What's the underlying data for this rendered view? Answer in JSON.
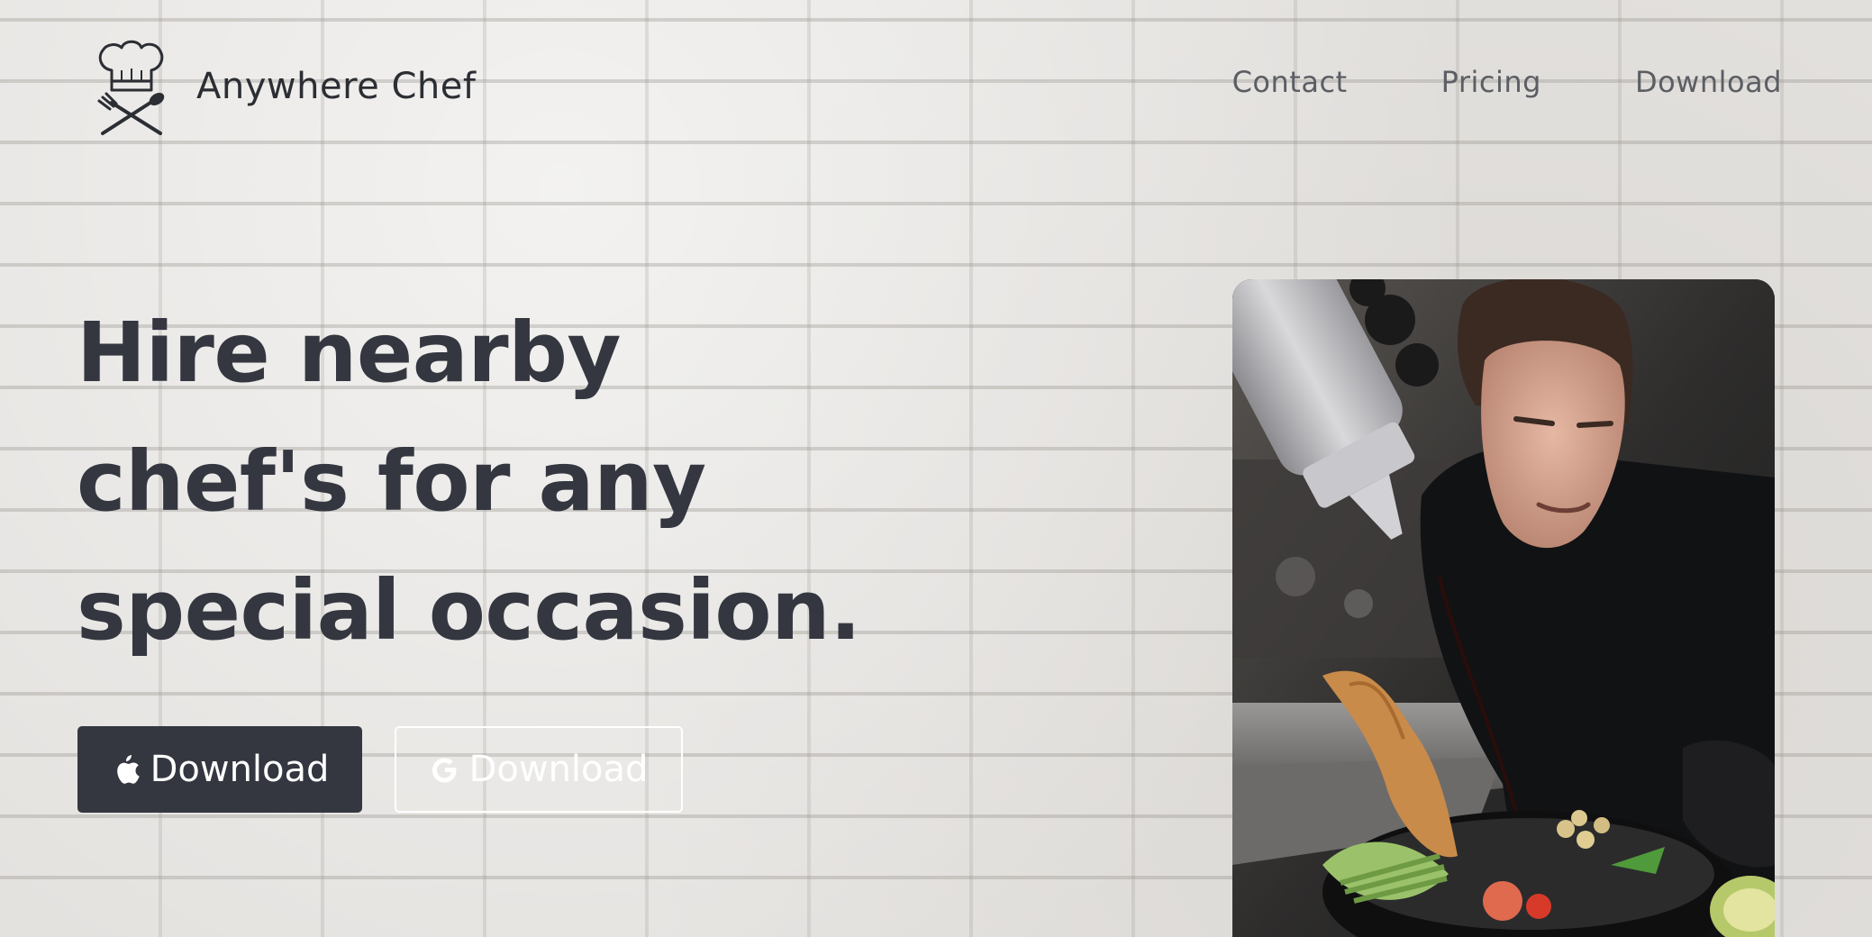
{
  "header": {
    "brand_name": "Anywhere Chef",
    "logo_icon": "chef-hat-utensils-icon",
    "nav": [
      {
        "label": "Contact"
      },
      {
        "label": "Pricing"
      },
      {
        "label": "Download"
      }
    ]
  },
  "hero": {
    "title_lines": [
      "Hire nearby",
      "chef's for any",
      "special occasion."
    ],
    "buttons": {
      "apple": {
        "label": "Download",
        "icon": "apple-icon"
      },
      "google": {
        "label": "Download",
        "icon": "google-icon"
      }
    },
    "image": {
      "subject": "chef-plating-food-photo"
    }
  },
  "colors": {
    "text_dark": "#343740",
    "nav_text": "#5b5e63",
    "button_dark": "#343740",
    "button_outline": "#ffffff",
    "background": "#e4e2df"
  }
}
